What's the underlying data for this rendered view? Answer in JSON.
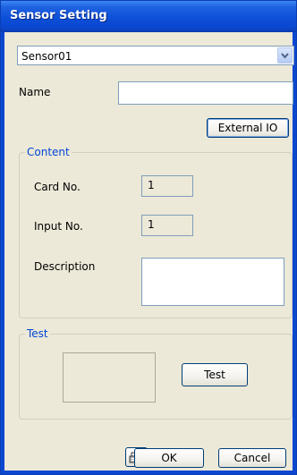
{
  "window": {
    "title": "Sensor Setting"
  },
  "sensor_select": {
    "value": "Sensor01",
    "arrow_icon": "chevron-down-icon"
  },
  "name": {
    "label": "Name",
    "value": ""
  },
  "buttons": {
    "external_io": "External IO",
    "test": "Test",
    "ok": "OK",
    "cancel": "Cancel",
    "keyboard_icon": "keyboard-icon"
  },
  "content": {
    "legend": "Content",
    "card_no_label": "Card No.",
    "card_no_value": "1",
    "input_no_label": "Input No.",
    "input_no_value": "1",
    "description_label": "Description",
    "description_value": ""
  },
  "test": {
    "legend": "Test"
  }
}
